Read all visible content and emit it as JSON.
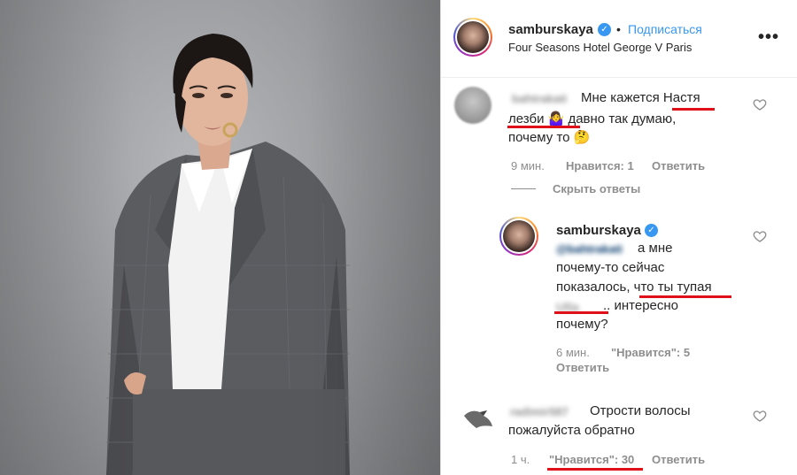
{
  "post": {
    "username": "samburskaya",
    "follow_label": "Подписаться",
    "dot": "•",
    "location": "Four Seasons Hotel George V Paris",
    "more_label": "•••"
  },
  "comments": [
    {
      "author": "bahtrakati",
      "lines": [
        "Мне кажется Настя",
        "лезби 🤷‍♀ давно так думаю,",
        "почему то 🤔"
      ],
      "time": "9 мин.",
      "likes": "Нравится: 1",
      "reply": "Ответить",
      "hide_replies": "Скрыть ответы"
    },
    {
      "author": "samburskaya",
      "mention": "@bahtrakati",
      "lines": [
        "а мне",
        "почему-то сейчас",
        "показалось, что ты тупая",
        "blurred.. интересно",
        "почему?"
      ],
      "line4_blur": "Ulla",
      "line4_rest": ".. интересно",
      "time": "6 мин.",
      "likes": "\"Нравится\": 5",
      "reply": "Ответить"
    },
    {
      "author": "radimir587",
      "lines": [
        "Отрости волосы",
        "пожалуйста обратно"
      ],
      "time": "1 ч.",
      "likes": "\"Нравится\": 30",
      "reply": "Ответить"
    }
  ],
  "colors": {
    "accent": "#3897f0",
    "muted": "#8e8e8e",
    "highlight": "#e0101a"
  }
}
